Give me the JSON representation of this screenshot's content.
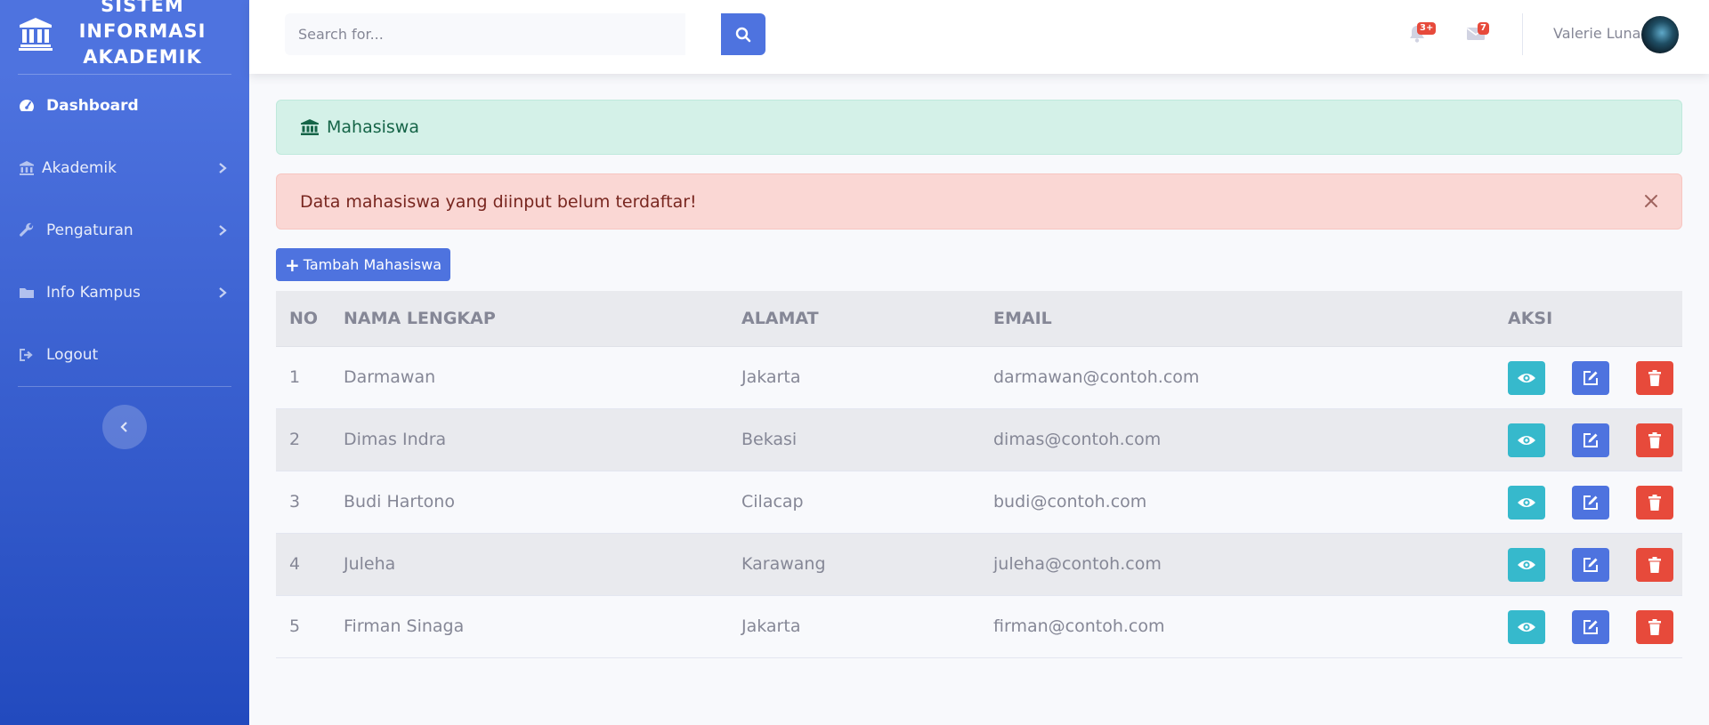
{
  "brand": {
    "title_lines": [
      "SISTEM",
      "INFORMASI",
      "AKADEMIK"
    ],
    "icon": "university-icon"
  },
  "sidebar": {
    "items": [
      {
        "label": "Dashboard",
        "icon": "tachometer-icon",
        "active": true
      },
      {
        "label": "Akademik",
        "icon": "university-icon",
        "has_submenu": true
      },
      {
        "label": "Pengaturan",
        "icon": "wrench-icon",
        "has_submenu": true
      },
      {
        "label": "Info Kampus",
        "icon": "folder-icon",
        "has_submenu": true
      },
      {
        "label": "Logout",
        "icon": "sign-out-icon"
      }
    ],
    "toggle_icon": "chevron-left-icon"
  },
  "topbar": {
    "search_placeholder": "Search for...",
    "search_icon": "search-icon",
    "alerts_badge": "3+",
    "messages_badge": "7",
    "user_name": "Valerie Luna"
  },
  "page": {
    "heading": "Mahasiswa",
    "heading_icon": "university-icon",
    "error_message": "Data mahasiswa yang diinput belum terdaftar!",
    "add_button": "Tambah Mahasiswa"
  },
  "table": {
    "headers": [
      "NO",
      "NAMA LENGKAP",
      "ALAMAT",
      "EMAIL",
      "AKSI"
    ],
    "rows": [
      {
        "no": "1",
        "name": "Darmawan",
        "address": "Jakarta",
        "email": "darmawan@contoh.com"
      },
      {
        "no": "2",
        "name": "Dimas Indra",
        "address": "Bekasi",
        "email": "dimas@contoh.com"
      },
      {
        "no": "3",
        "name": "Budi Hartono",
        "address": "Cilacap",
        "email": "budi@contoh.com"
      },
      {
        "no": "4",
        "name": "Juleha",
        "address": "Karawang",
        "email": "juleha@contoh.com"
      },
      {
        "no": "5",
        "name": "Firman Sinaga",
        "address": "Jakarta",
        "email": "firman@contoh.com"
      }
    ]
  },
  "colors": {
    "primary": "#4e73df",
    "info": "#36b9cc",
    "danger": "#e74a3b",
    "success_bg": "#d4f1e8",
    "danger_bg": "#fad7d4"
  }
}
